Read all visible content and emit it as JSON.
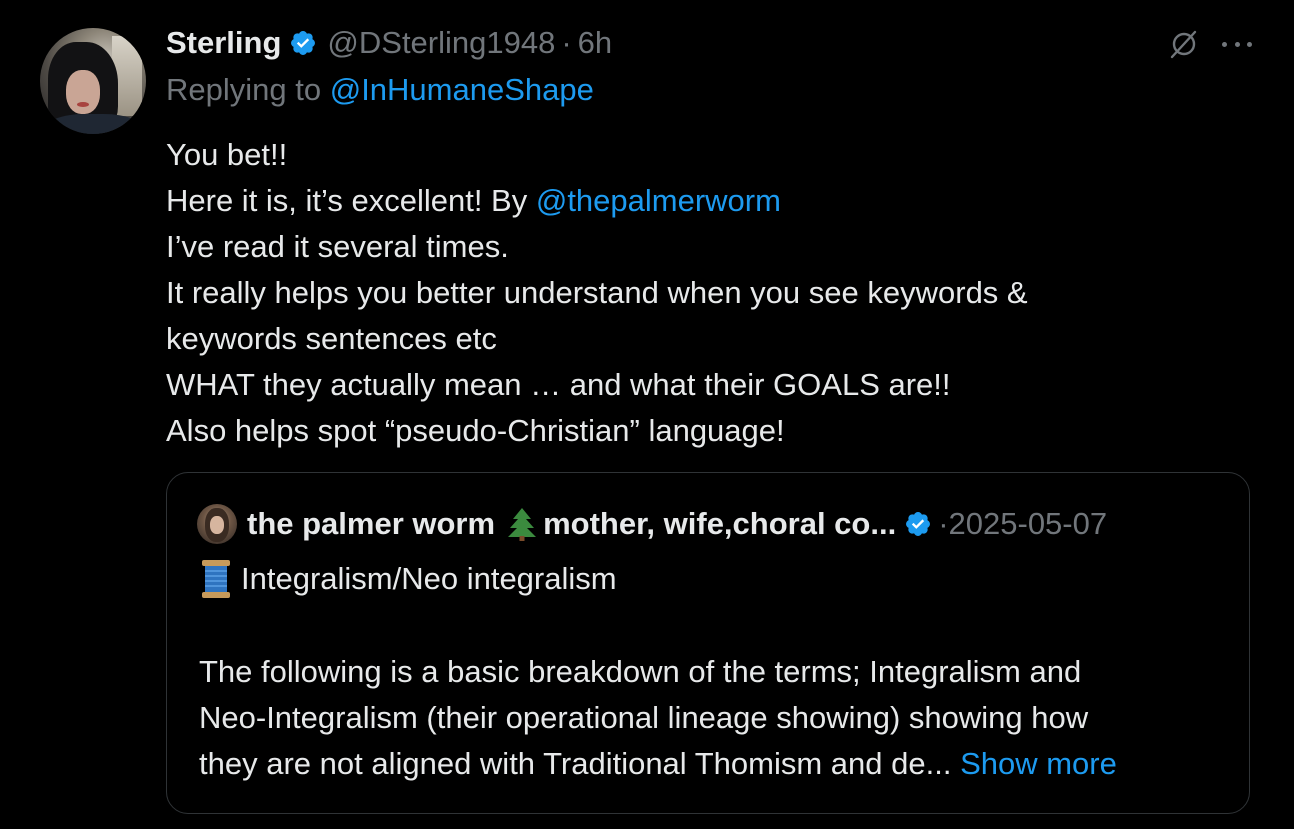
{
  "tweet": {
    "author_name": "Sterling",
    "handle": "@DSterling1948",
    "separator": "·",
    "time": "6h",
    "replying_prefix": "Replying to",
    "replying_handle": "@InHumaneShape",
    "body": {
      "line1": "You bet!!",
      "line2_pre": "Here it is, it’s excellent! By ",
      "line2_mention": "@thepalmerworm",
      "line3": "I’ve read it several times.",
      "line4": "It really helps you better understand when you see keywords &",
      "line5": "keywords sentences etc",
      "line6": "WHAT they actually mean … and what their GOALS are!!",
      "line7": "Also helps spot “pseudo-Christian” language!"
    },
    "icons": {
      "verified": "verified-badge-icon",
      "grok": "grok-icon",
      "more": "more-icon"
    },
    "colors": {
      "background": "#000000",
      "text": "#e7e9ea",
      "muted": "#71767b",
      "link": "#1d9bf0",
      "verified": "#1d9bf0",
      "border": "#2f3336"
    }
  },
  "quote": {
    "author_name": "the palmer worm",
    "tree_emoji": "evergreen-tree-icon",
    "author_bio": "mother, wife,choral co...",
    "separator": "·",
    "date": "2025-05-07",
    "thread_emoji": "thread-spool-icon",
    "thread_title": "Integralism/Neo integralism",
    "body": {
      "line1": "The following is a basic breakdown of the terms; Integralism and",
      "line2": "Neo-Integralism (their operational lineage showing) showing how",
      "line3_pre": "they are not aligned with Traditional Thomism and de... ",
      "show_more": "Show more"
    }
  }
}
